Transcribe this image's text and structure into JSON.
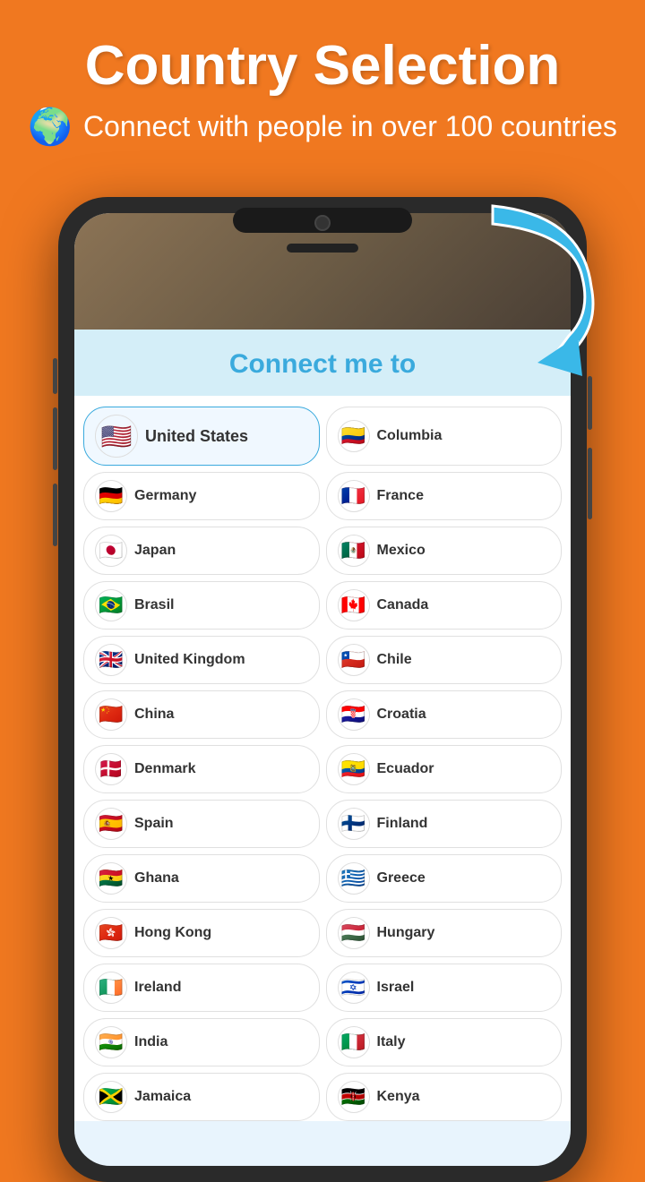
{
  "page": {
    "background_color": "#F07820",
    "title": "Country Selection",
    "subtitle": "Connect with people in over 100 countries",
    "globe_icon": "🌐",
    "arrow_color": "#3ab8e8"
  },
  "connect_section": {
    "header": "Connect me to"
  },
  "countries": [
    {
      "id": 1,
      "name": "United States",
      "flag": "🇺🇸",
      "selected": true,
      "col": "left"
    },
    {
      "id": 2,
      "name": "Columbia",
      "flag": "🇨🇴",
      "selected": false,
      "col": "right"
    },
    {
      "id": 3,
      "name": "Germany",
      "flag": "🇩🇪",
      "selected": false,
      "col": "left"
    },
    {
      "id": 4,
      "name": "France",
      "flag": "🇫🇷",
      "selected": false,
      "col": "right"
    },
    {
      "id": 5,
      "name": "Japan",
      "flag": "🇯🇵",
      "selected": false,
      "col": "left"
    },
    {
      "id": 6,
      "name": "Mexico",
      "flag": "🇲🇽",
      "selected": false,
      "col": "right"
    },
    {
      "id": 7,
      "name": "Brasil",
      "flag": "🇧🇷",
      "selected": false,
      "col": "left"
    },
    {
      "id": 8,
      "name": "Canada",
      "flag": "🇨🇦",
      "selected": false,
      "col": "right"
    },
    {
      "id": 9,
      "name": "United Kingdom",
      "flag": "🇬🇧",
      "selected": false,
      "col": "left"
    },
    {
      "id": 10,
      "name": "Chile",
      "flag": "🇨🇱",
      "selected": false,
      "col": "right"
    },
    {
      "id": 11,
      "name": "China",
      "flag": "🇨🇳",
      "selected": false,
      "col": "left"
    },
    {
      "id": 12,
      "name": "Croatia",
      "flag": "🇭🇷",
      "selected": false,
      "col": "right"
    },
    {
      "id": 13,
      "name": "Denmark",
      "flag": "🇩🇰",
      "selected": false,
      "col": "left"
    },
    {
      "id": 14,
      "name": "Ecuador",
      "flag": "🇪🇨",
      "selected": false,
      "col": "right"
    },
    {
      "id": 15,
      "name": "Spain",
      "flag": "🇪🇸",
      "selected": false,
      "col": "left"
    },
    {
      "id": 16,
      "name": "Finland",
      "flag": "🇫🇮",
      "selected": false,
      "col": "right"
    },
    {
      "id": 17,
      "name": "Ghana",
      "flag": "🇬🇭",
      "selected": false,
      "col": "left"
    },
    {
      "id": 18,
      "name": "Greece",
      "flag": "🇬🇷",
      "selected": false,
      "col": "right"
    },
    {
      "id": 19,
      "name": "Hong Kong",
      "flag": "🇭🇰",
      "selected": false,
      "col": "left"
    },
    {
      "id": 20,
      "name": "Hungary",
      "flag": "🇭🇺",
      "selected": false,
      "col": "right"
    },
    {
      "id": 21,
      "name": "Ireland",
      "flag": "🇮🇪",
      "selected": false,
      "col": "left"
    },
    {
      "id": 22,
      "name": "Israel",
      "flag": "🇮🇱",
      "selected": false,
      "col": "right"
    },
    {
      "id": 23,
      "name": "India",
      "flag": "🇮🇳",
      "selected": false,
      "col": "left"
    },
    {
      "id": 24,
      "name": "Italy",
      "flag": "🇮🇹",
      "selected": false,
      "col": "right"
    },
    {
      "id": 25,
      "name": "Jamaica",
      "flag": "🇯🇲",
      "selected": false,
      "col": "left"
    },
    {
      "id": 26,
      "name": "Kenya",
      "flag": "🇰🇪",
      "selected": false,
      "col": "right"
    }
  ]
}
